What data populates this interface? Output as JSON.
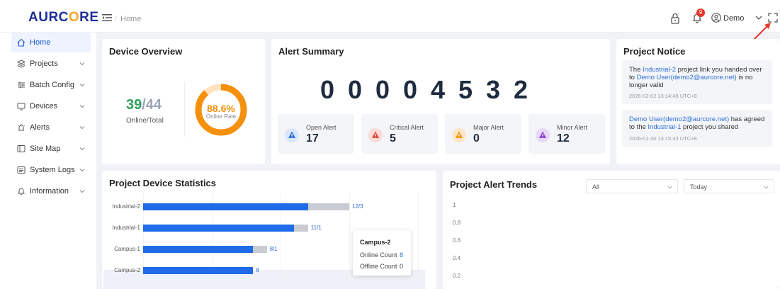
{
  "header": {
    "logo_pre": "AURC",
    "logo_o": "O",
    "logo_post": "RE",
    "breadcrumb_sep": "/",
    "breadcrumb": "Home",
    "notification_count": "9",
    "user_name": "Demo"
  },
  "sidebar": {
    "items": [
      {
        "label": "Home",
        "icon": "home-icon"
      },
      {
        "label": "Projects",
        "icon": "layers-icon"
      },
      {
        "label": "Batch Config",
        "icon": "sliders-icon"
      },
      {
        "label": "Devices",
        "icon": "monitor-icon"
      },
      {
        "label": "Alerts",
        "icon": "alert-icon"
      },
      {
        "label": "Site Map",
        "icon": "map-icon"
      },
      {
        "label": "System Logs",
        "icon": "log-icon"
      },
      {
        "label": "Information",
        "icon": "bell-icon"
      }
    ]
  },
  "overview": {
    "title": "Device Overview",
    "online": "39",
    "total_sep": "/44",
    "caption": "Online/Total",
    "rate": "88.6%",
    "rate_value": 0.886,
    "rate_label": "Online Rate",
    "ring_color": "#f5900b"
  },
  "alert_summary": {
    "title": "Alert Summary",
    "digits": [
      "0",
      "0",
      "0",
      "0",
      "4",
      "5",
      "3",
      "2"
    ],
    "boxes": [
      {
        "label": "Open Alert",
        "value": "17",
        "color": "#2f6ed8"
      },
      {
        "label": "Critical Alert",
        "value": "5",
        "color": "#e5473b"
      },
      {
        "label": "Major Alert",
        "value": "0",
        "color": "#f5900b"
      },
      {
        "label": "Minor Alert",
        "value": "12",
        "color": "#8a3fd1"
      }
    ]
  },
  "notice": {
    "title": "Project Notice",
    "items": [
      {
        "pre": "The ",
        "link1": "Industrial-2",
        "mid": " project link you handed over to ",
        "link2": "Demo User(demo2@aurcore.net)",
        "post": " is no longer valid",
        "time": "2026-02-02 13:14:48 UTC+8"
      },
      {
        "link1": "Demo User(demo2@aurcore.net)",
        "mid": " has agreed to the ",
        "link2": "Industrial-1",
        "post": " project you shared",
        "time": "2026-01-30 13:15:33 UTC+8"
      }
    ]
  },
  "device_stats": {
    "title": "Project Device Statistics",
    "tooltip": {
      "title": "Campus-2",
      "online_label": "Online Count",
      "online_value": "8",
      "offline_label": "Offline Count",
      "offline_value": "0"
    }
  },
  "chart_data": [
    {
      "type": "bar",
      "orientation": "horizontal",
      "stacked": true,
      "categories": [
        "Industrial-2",
        "Industrial-1",
        "Campus-1",
        "Campus-2"
      ],
      "series": [
        {
          "name": "Online Count",
          "values": [
            12,
            11,
            8,
            8
          ],
          "color": "#1f6be8"
        },
        {
          "name": "Offline Count",
          "values": [
            3,
            1,
            1,
            0
          ],
          "color": "#c8cbd2"
        }
      ],
      "data_labels": [
        "12/3",
        "11/1",
        "8/1",
        "8"
      ],
      "xlim": [
        0,
        20
      ],
      "grid": true
    },
    {
      "type": "line",
      "title": "Project Alert Trends",
      "y_ticks": [
        "1",
        "0.8",
        "0.6",
        "0.4",
        "0.2"
      ],
      "series": [],
      "grid": false
    }
  ],
  "trends": {
    "title": "Project Alert Trends",
    "filter_project": "All",
    "filter_range": "Today"
  }
}
